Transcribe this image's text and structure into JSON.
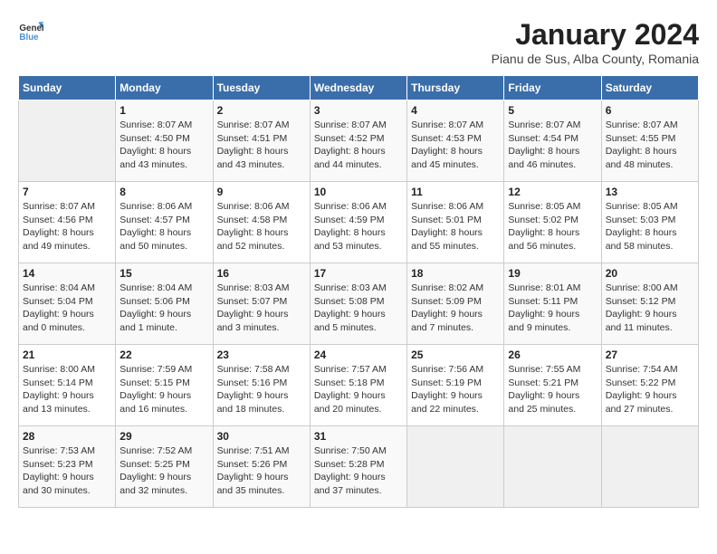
{
  "header": {
    "logo_general": "General",
    "logo_blue": "Blue",
    "month_year": "January 2024",
    "location": "Pianu de Sus, Alba County, Romania"
  },
  "days_of_week": [
    "Sunday",
    "Monday",
    "Tuesday",
    "Wednesday",
    "Thursday",
    "Friday",
    "Saturday"
  ],
  "weeks": [
    [
      {
        "day": "",
        "info": ""
      },
      {
        "day": "1",
        "info": "Sunrise: 8:07 AM\nSunset: 4:50 PM\nDaylight: 8 hours\nand 43 minutes."
      },
      {
        "day": "2",
        "info": "Sunrise: 8:07 AM\nSunset: 4:51 PM\nDaylight: 8 hours\nand 43 minutes."
      },
      {
        "day": "3",
        "info": "Sunrise: 8:07 AM\nSunset: 4:52 PM\nDaylight: 8 hours\nand 44 minutes."
      },
      {
        "day": "4",
        "info": "Sunrise: 8:07 AM\nSunset: 4:53 PM\nDaylight: 8 hours\nand 45 minutes."
      },
      {
        "day": "5",
        "info": "Sunrise: 8:07 AM\nSunset: 4:54 PM\nDaylight: 8 hours\nand 46 minutes."
      },
      {
        "day": "6",
        "info": "Sunrise: 8:07 AM\nSunset: 4:55 PM\nDaylight: 8 hours\nand 48 minutes."
      }
    ],
    [
      {
        "day": "7",
        "info": "Sunrise: 8:07 AM\nSunset: 4:56 PM\nDaylight: 8 hours\nand 49 minutes."
      },
      {
        "day": "8",
        "info": "Sunrise: 8:06 AM\nSunset: 4:57 PM\nDaylight: 8 hours\nand 50 minutes."
      },
      {
        "day": "9",
        "info": "Sunrise: 8:06 AM\nSunset: 4:58 PM\nDaylight: 8 hours\nand 52 minutes."
      },
      {
        "day": "10",
        "info": "Sunrise: 8:06 AM\nSunset: 4:59 PM\nDaylight: 8 hours\nand 53 minutes."
      },
      {
        "day": "11",
        "info": "Sunrise: 8:06 AM\nSunset: 5:01 PM\nDaylight: 8 hours\nand 55 minutes."
      },
      {
        "day": "12",
        "info": "Sunrise: 8:05 AM\nSunset: 5:02 PM\nDaylight: 8 hours\nand 56 minutes."
      },
      {
        "day": "13",
        "info": "Sunrise: 8:05 AM\nSunset: 5:03 PM\nDaylight: 8 hours\nand 58 minutes."
      }
    ],
    [
      {
        "day": "14",
        "info": "Sunrise: 8:04 AM\nSunset: 5:04 PM\nDaylight: 9 hours\nand 0 minutes."
      },
      {
        "day": "15",
        "info": "Sunrise: 8:04 AM\nSunset: 5:06 PM\nDaylight: 9 hours\nand 1 minute."
      },
      {
        "day": "16",
        "info": "Sunrise: 8:03 AM\nSunset: 5:07 PM\nDaylight: 9 hours\nand 3 minutes."
      },
      {
        "day": "17",
        "info": "Sunrise: 8:03 AM\nSunset: 5:08 PM\nDaylight: 9 hours\nand 5 minutes."
      },
      {
        "day": "18",
        "info": "Sunrise: 8:02 AM\nSunset: 5:09 PM\nDaylight: 9 hours\nand 7 minutes."
      },
      {
        "day": "19",
        "info": "Sunrise: 8:01 AM\nSunset: 5:11 PM\nDaylight: 9 hours\nand 9 minutes."
      },
      {
        "day": "20",
        "info": "Sunrise: 8:00 AM\nSunset: 5:12 PM\nDaylight: 9 hours\nand 11 minutes."
      }
    ],
    [
      {
        "day": "21",
        "info": "Sunrise: 8:00 AM\nSunset: 5:14 PM\nDaylight: 9 hours\nand 13 minutes."
      },
      {
        "day": "22",
        "info": "Sunrise: 7:59 AM\nSunset: 5:15 PM\nDaylight: 9 hours\nand 16 minutes."
      },
      {
        "day": "23",
        "info": "Sunrise: 7:58 AM\nSunset: 5:16 PM\nDaylight: 9 hours\nand 18 minutes."
      },
      {
        "day": "24",
        "info": "Sunrise: 7:57 AM\nSunset: 5:18 PM\nDaylight: 9 hours\nand 20 minutes."
      },
      {
        "day": "25",
        "info": "Sunrise: 7:56 AM\nSunset: 5:19 PM\nDaylight: 9 hours\nand 22 minutes."
      },
      {
        "day": "26",
        "info": "Sunrise: 7:55 AM\nSunset: 5:21 PM\nDaylight: 9 hours\nand 25 minutes."
      },
      {
        "day": "27",
        "info": "Sunrise: 7:54 AM\nSunset: 5:22 PM\nDaylight: 9 hours\nand 27 minutes."
      }
    ],
    [
      {
        "day": "28",
        "info": "Sunrise: 7:53 AM\nSunset: 5:23 PM\nDaylight: 9 hours\nand 30 minutes."
      },
      {
        "day": "29",
        "info": "Sunrise: 7:52 AM\nSunset: 5:25 PM\nDaylight: 9 hours\nand 32 minutes."
      },
      {
        "day": "30",
        "info": "Sunrise: 7:51 AM\nSunset: 5:26 PM\nDaylight: 9 hours\nand 35 minutes."
      },
      {
        "day": "31",
        "info": "Sunrise: 7:50 AM\nSunset: 5:28 PM\nDaylight: 9 hours\nand 37 minutes."
      },
      {
        "day": "",
        "info": ""
      },
      {
        "day": "",
        "info": ""
      },
      {
        "day": "",
        "info": ""
      }
    ]
  ]
}
